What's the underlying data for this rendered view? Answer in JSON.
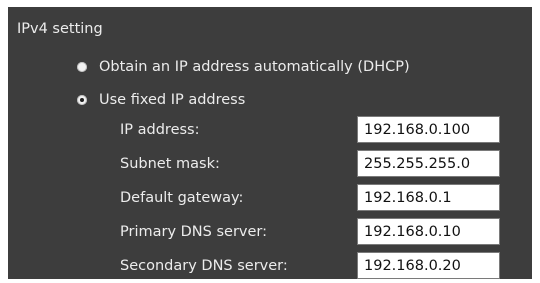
{
  "section": {
    "title": "IPv4 setting"
  },
  "ip_mode": {
    "options": [
      {
        "label": "Obtain an IP address automatically (DHCP)",
        "selected": false
      },
      {
        "label": "Use fixed IP address",
        "selected": true
      }
    ]
  },
  "fields": [
    {
      "label": "IP address:",
      "value": "192.168.0.100"
    },
    {
      "label": "Subnet mask:",
      "value": "255.255.255.0"
    },
    {
      "label": "Default gateway:",
      "value": "192.168.0.1"
    },
    {
      "label": "Primary DNS server:",
      "value": "192.168.0.10"
    },
    {
      "label": "Secondary DNS server:",
      "value": "192.168.0.20"
    }
  ],
  "colors": {
    "panel_background": "#3d3d3d",
    "text": "#ececec",
    "input_background": "#ffffff"
  }
}
